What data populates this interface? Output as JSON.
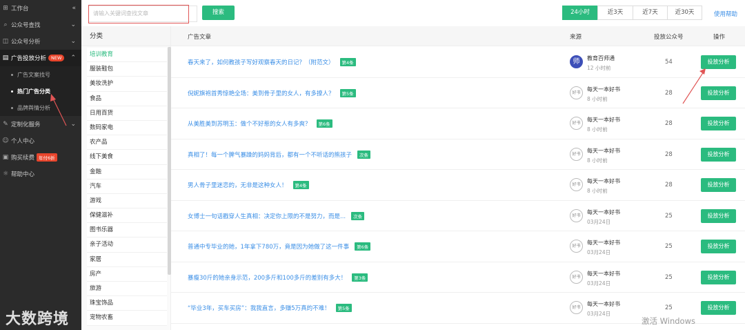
{
  "sidebar": {
    "items": [
      {
        "label": "工作台",
        "icon": "grid-icon",
        "chevron": "«"
      },
      {
        "label": "公众号查找",
        "icon": "magnify-icon",
        "chevron": "⌄"
      },
      {
        "label": "公众号分析",
        "icon": "chart-icon",
        "chevron": "⌄"
      },
      {
        "label": "广告投放分析",
        "icon": "ad-icon",
        "badge": "NEW",
        "chevron": "⌃"
      },
      {
        "label": "定制化服务",
        "icon": "puzzle-icon",
        "chevron": "⌄"
      },
      {
        "label": "个人中心",
        "icon": "user-icon"
      },
      {
        "label": "购买续费",
        "icon": "cart-icon",
        "badge": "年付6折"
      },
      {
        "label": "帮助中心",
        "icon": "bulb-icon"
      }
    ],
    "subitems": [
      {
        "label": "广告文案找号"
      },
      {
        "label": "热门广告分类"
      },
      {
        "label": "品牌舆情分析"
      }
    ]
  },
  "search": {
    "placeholder": "请输入关键词查找文章",
    "button": "搜索"
  },
  "ranges": [
    "24小时",
    "近3天",
    "近7天",
    "近30天"
  ],
  "active_range": "24小时",
  "help_link": "使用帮助",
  "category": {
    "header": "分类",
    "items": [
      "培训教育",
      "服装鞋包",
      "美妆洗护",
      "食品",
      "日用百货",
      "数码家电",
      "农产品",
      "线下美食",
      "金融",
      "汽车",
      "游戏",
      "保健滋补",
      "图书乐器",
      "亲子活动",
      "家居",
      "房产",
      "旅游",
      "珠宝饰品",
      "宠物农畜"
    ],
    "active": "培训教育"
  },
  "table": {
    "headers": {
      "title": "广告文章",
      "source": "来源",
      "count": "投放公众号",
      "action": "操作"
    },
    "rows": [
      {
        "title": "春天来了，如何教孩子写好观察春天的日记？（附范文）",
        "tag": "第4条",
        "source": "教育百师通",
        "avatar": "师",
        "time": "12 小时前",
        "count": "54",
        "action": "投放分析"
      },
      {
        "title": "倪妮旗袍首秀惊艳全场：美到骨子里的女人，有多撩人？",
        "tag": "第5条",
        "source": "每天一本好书",
        "avatar": "好书",
        "time": "8 小时前",
        "count": "28",
        "action": "投放分析"
      },
      {
        "title": "从美胜美到苏明玉：做个不好惹的女人有多爽？",
        "tag": "第6条",
        "source": "每天一本好书",
        "avatar": "好书",
        "time": "8 小时前",
        "count": "28",
        "action": "投放分析"
      },
      {
        "title": "真相了！每一个脾气暴躁的妈妈背后，都有一个不听话的熊孩子",
        "tag": "次条",
        "source": "每天一本好书",
        "avatar": "好书",
        "time": "8 小时前",
        "count": "28",
        "action": "投放分析"
      },
      {
        "title": "男人骨子里迷恋的，无非是这种女人！",
        "tag": "第4条",
        "source": "每天一本好书",
        "avatar": "好书",
        "time": "8 小时前",
        "count": "28",
        "action": "投放分析"
      },
      {
        "title": "女博士一句话戳穿人生真相：决定你上限的不是努力，而是...",
        "tag": "次条",
        "source": "每天一本好书",
        "avatar": "好书",
        "time": "03月24日",
        "count": "25",
        "action": "投放分析"
      },
      {
        "title": "普通中专毕业的她，1年拿下780万，竟是因为她做了这一件事",
        "tag": "第6条",
        "source": "每天一本好书",
        "avatar": "好书",
        "time": "03月24日",
        "count": "25",
        "action": "投放分析"
      },
      {
        "title": "暴瘦30斤的她亲身示范，200多斤和100多斤的差别有多大！",
        "tag": "第3条",
        "source": "每天一本好书",
        "avatar": "好书",
        "time": "03月24日",
        "count": "25",
        "action": "投放分析"
      },
      {
        "title": "“毕业3年，买车买房”：我我直言，多赚5万真的不难！",
        "tag": "第5条",
        "source": "每天一本好书",
        "avatar": "好书",
        "time": "03月24日",
        "count": "25",
        "action": "投放分析"
      }
    ]
  },
  "watermark": "大数跨境",
  "win_activation": "激活 Windows",
  "colors": {
    "accent": "#2bbb7f",
    "link": "#3a8ee6",
    "sidebar": "#2b2b2b",
    "highlight": "#e05555"
  }
}
